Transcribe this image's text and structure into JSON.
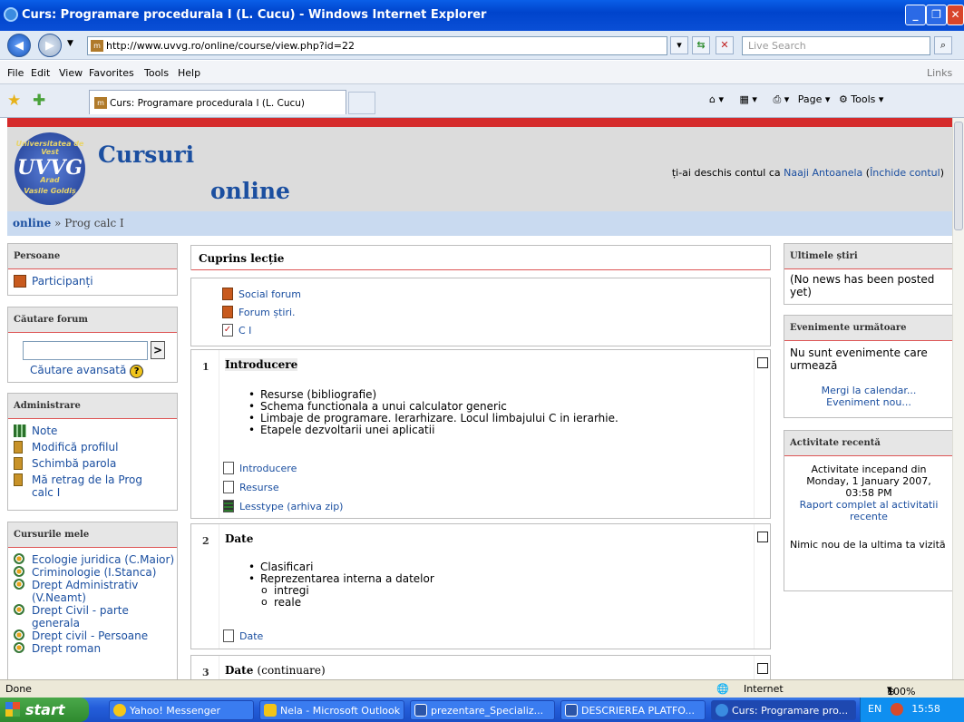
{
  "window": {
    "title": "Curs: Programare procedurala I (L. Cucu) - Windows Internet Explorer"
  },
  "address": {
    "url": "http://www.uvvg.ro/online/course/view.php?id=22",
    "search_placeholder": "Live Search"
  },
  "menu": [
    "File",
    "Edit",
    "View",
    "Favorites",
    "Tools",
    "Help"
  ],
  "menu_links": "Links",
  "tab": {
    "label": "Curs: Programare procedurala I (L. Cucu)",
    "page_label": "Page",
    "tools_label": "Tools"
  },
  "header": {
    "logo_top": "Universitatea de Vest",
    "logo_mid": "UVVG",
    "logo_city": "Arad",
    "logo_bottom": "Vasile Goldiș",
    "title1": "Cursuri",
    "title2": "online",
    "login_prefix": "ți-ai deschis contul ca",
    "login_user": "Naaji Antoanela",
    "logout_open": "(",
    "logout": "Închide contul",
    "logout_close": ")"
  },
  "breadcrumb": {
    "home": "online",
    "sep": "»",
    "current": "Prog calc I"
  },
  "left": {
    "persoane": {
      "title": "Persoane",
      "items": [
        "Participanți"
      ]
    },
    "cautare": {
      "title": "Căutare forum",
      "go": ">",
      "advanced": "Căutare avansată",
      "help": "?"
    },
    "admin": {
      "title": "Administrare",
      "items": [
        "Note",
        "Modifică profilul",
        "Schimbă parola",
        "Mă retrag de la Prog calc I"
      ]
    },
    "cursuri": {
      "title": "Cursurile mele",
      "items": [
        "Ecologie juridica (C.Maior)",
        "Criminologie (I.Stanca)",
        "Drept Administrativ (V.Neamt)",
        "Drept Civil - parte generala",
        "Drept civil - Persoane",
        "Drept roman"
      ]
    }
  },
  "main": {
    "title": "Cuprins lecție",
    "top_resources": [
      "Social forum",
      "Forum știri.",
      "C I"
    ],
    "sections": [
      {
        "num": "1",
        "title": "Introducere",
        "bullets": [
          "Resurse (bibliografie)",
          "Schema functionala a unui calculator generic",
          "Limbaje de programare. Ierarhizare. Locul limbajului C in ierarhie.",
          "Etapele dezvoltarii unei aplicatii"
        ],
        "resources": [
          "Introducere",
          "Resurse",
          "Lesstype (arhiva zip)"
        ]
      },
      {
        "num": "2",
        "title": "Date",
        "bullets": [
          "Clasificari",
          "Reprezentarea interna a datelor"
        ],
        "subbullets": [
          "intregi",
          "reale"
        ],
        "resources": [
          "Date"
        ]
      },
      {
        "num": "3",
        "title": "Date",
        "title_suffix": "(continuare)"
      }
    ]
  },
  "right": {
    "news": {
      "title": "Ultimele știri",
      "text": "(No news has been posted yet)"
    },
    "events": {
      "title": "Evenimente următoare",
      "text": "Nu sunt evenimente care urmează",
      "calendar": "Mergi la calendar...",
      "new_event": "Eveniment nou..."
    },
    "recent": {
      "title": "Activitate recentă",
      "line1": "Activitate incepand din",
      "line2": "Monday, 1 January 2007,",
      "line3": "03:58 PM",
      "report": "Raport complet al activitatii recente",
      "none": "Nimic nou de la ultima ta vizită"
    }
  },
  "status": {
    "left": "Done",
    "zone": "Internet",
    "zoom": "100%"
  },
  "taskbar": {
    "start": "start",
    "items": [
      "Yahoo! Messenger",
      "Nela - Microsoft Outlook",
      "prezentare_Specializ...",
      "DESCRIEREA PLATFO...",
      "Curs: Programare pro..."
    ],
    "lang": "EN",
    "time": "15:58"
  }
}
